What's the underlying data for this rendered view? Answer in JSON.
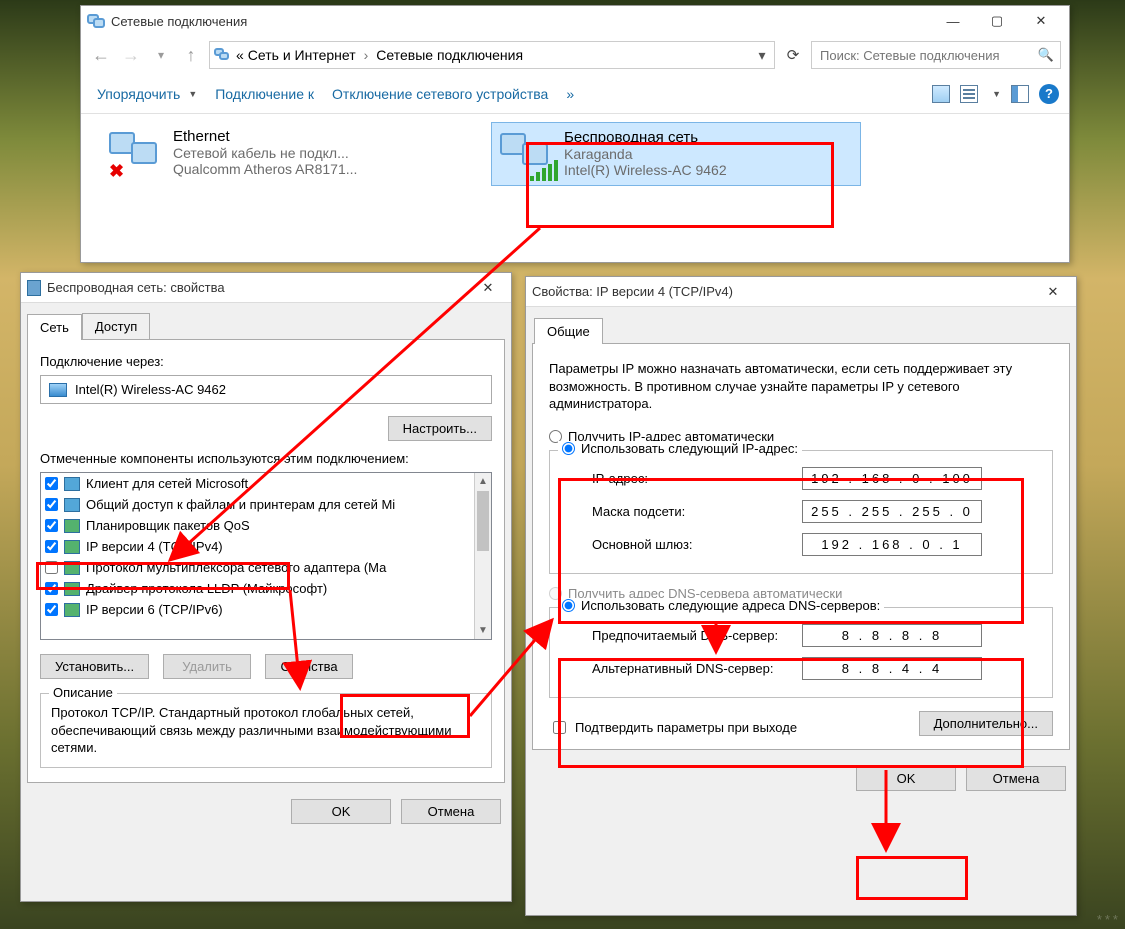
{
  "explorer": {
    "title": "Сетевые подключения",
    "breadcrumb": {
      "root": "«",
      "a": "Сеть и Интернет",
      "b": "Сетевые подключения"
    },
    "search_placeholder": "Поиск: Сетевые подключения",
    "toolbar": {
      "organize": "Упорядочить",
      "connect_to": "Подключение к",
      "disable": "Отключение сетевого устройства",
      "more": "»"
    },
    "items": [
      {
        "name": "Ethernet",
        "line2": "Сетевой кабель не подкл...",
        "line3": "Qualcomm Atheros AR8171...",
        "kind": "wired"
      },
      {
        "name": "Беспроводная сеть",
        "line2": "Karaganda",
        "line3": "Intel(R) Wireless-AC 9462",
        "kind": "wifi",
        "selected": true
      }
    ]
  },
  "props": {
    "title": "Беспроводная сеть: свойства",
    "tabs": {
      "network": "Сеть",
      "access": "Доступ"
    },
    "connect_via_label": "Подключение через:",
    "adapter": "Intel(R) Wireless-AC 9462",
    "configure_btn": "Настроить...",
    "components_label": "Отмеченные компоненты используются этим подключением:",
    "components": [
      {
        "checked": true,
        "label": "Клиент для сетей Microsoft"
      },
      {
        "checked": true,
        "label": "Общий доступ к файлам и принтерам для сетей Mi"
      },
      {
        "checked": true,
        "label": "Планировщик пакетов QoS"
      },
      {
        "checked": true,
        "label": "IP версии 4 (TCP/IPv4)"
      },
      {
        "checked": false,
        "label": "Протокол мультиплексора сетевого адаптера (Ма"
      },
      {
        "checked": true,
        "label": "Драйвер протокола LLDP (Майкрософт)"
      },
      {
        "checked": true,
        "label": "IP версии 6 (TCP/IPv6)"
      }
    ],
    "install_btn": "Установить...",
    "remove_btn": "Удалить",
    "properties_btn": "Свойства",
    "description_legend": "Описание",
    "description_text": "Протокол TCP/IP. Стандартный протокол глобальных сетей, обеспечивающий связь между различными взаимодействующими сетями.",
    "ok_btn": "OK",
    "cancel_btn": "Отмена"
  },
  "ipv4": {
    "title": "Свойства: IP версии 4 (TCP/IPv4)",
    "tab_general": "Общие",
    "intro": "Параметры IP можно назначать автоматически, если сеть поддерживает эту возможность. В противном случае узнайте параметры IP у сетевого администратора.",
    "radio_auto_ip": "Получить IP-адрес автоматически",
    "radio_manual_ip": "Использовать следующий IP-адрес:",
    "k_ip": "IP-адрес:",
    "k_mask": "Маска подсети:",
    "k_gw": "Основной шлюз:",
    "v_ip": "192 . 168 .  0  . 100",
    "v_mask": "255 . 255 . 255 .  0",
    "v_gw": "192 . 168 .  0  .  1",
    "radio_auto_dns": "Получить адрес DNS-сервера автоматически",
    "radio_manual_dns": "Использовать следующие адреса DNS-серверов:",
    "k_dns1": "Предпочитаемый DNS-сервер:",
    "k_dns2": "Альтернативный DNS-сервер:",
    "v_dns1": "8  .  8  .  8  .  8",
    "v_dns2": "8  .  8  .  4  .  4",
    "confirm_on_exit": "Подтвердить параметры при выходе",
    "advanced_btn": "Дополнительно...",
    "ok_btn": "OK",
    "cancel_btn": "Отмена"
  }
}
